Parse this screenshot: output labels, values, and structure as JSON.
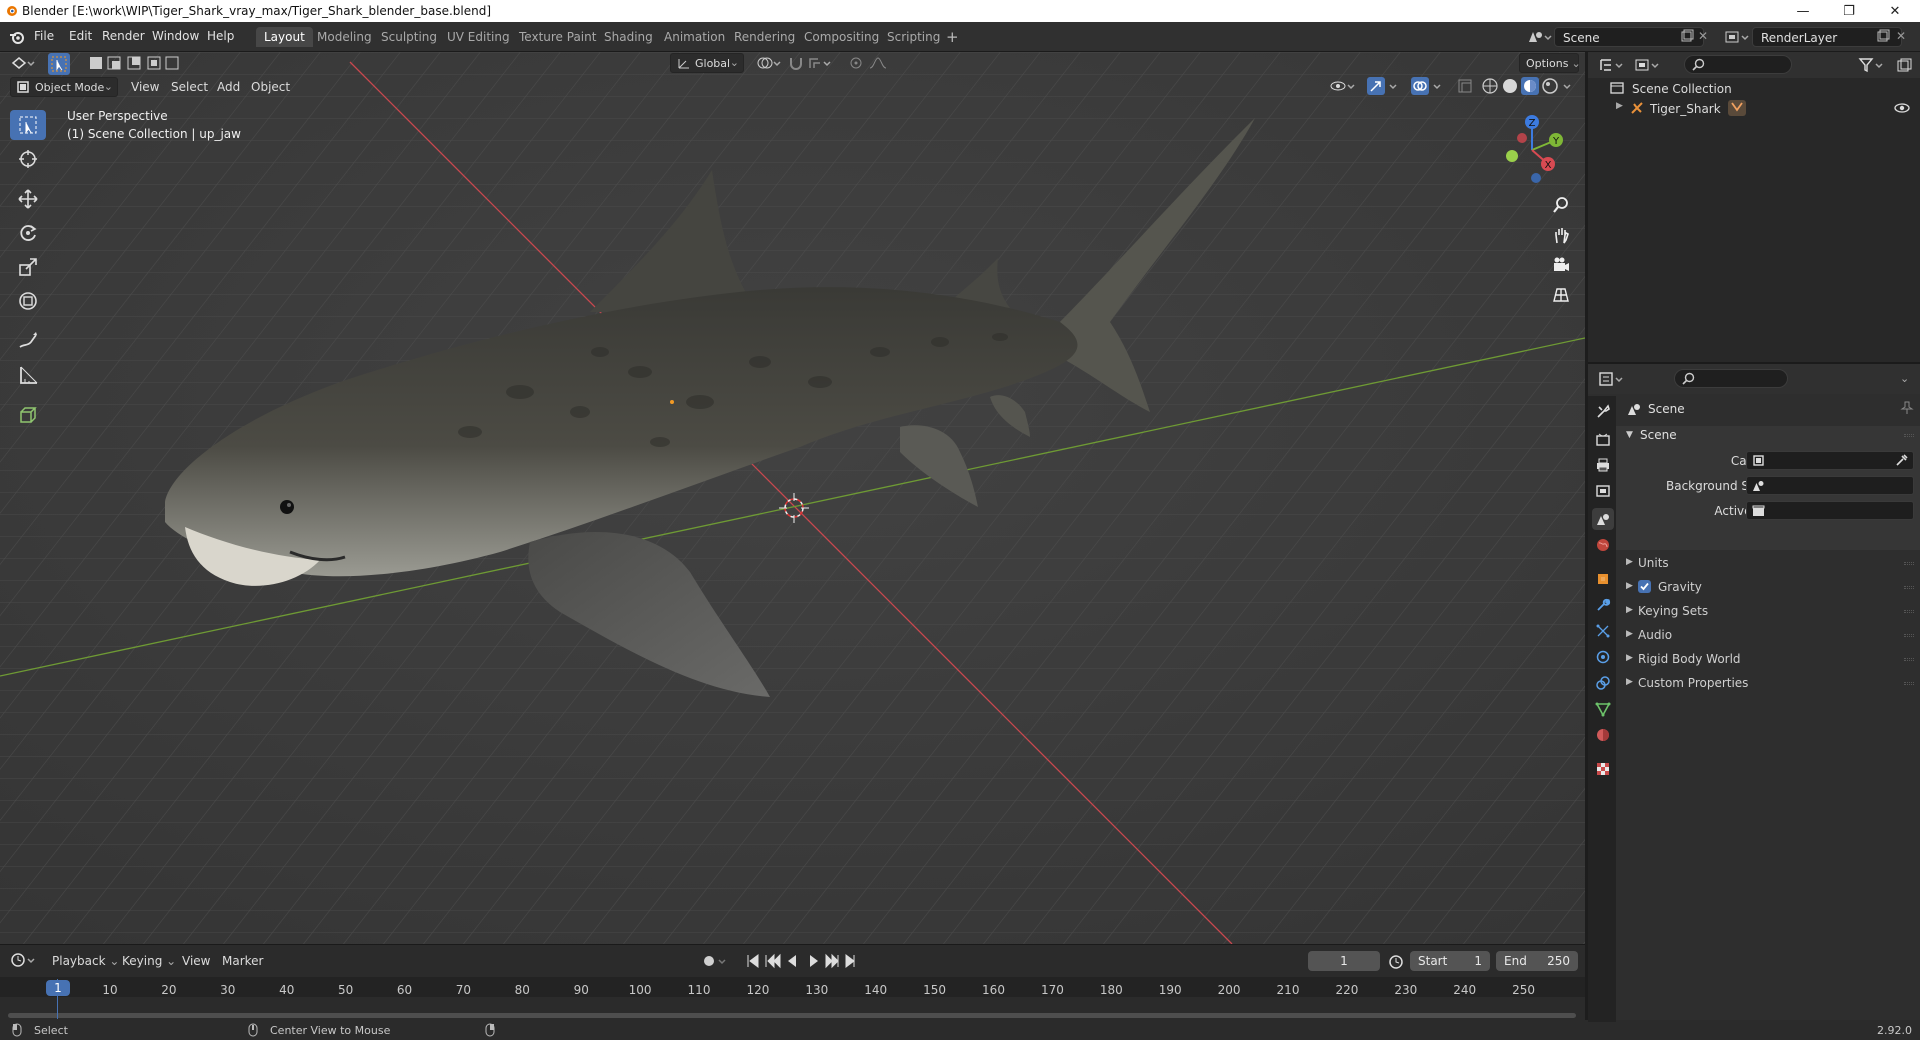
{
  "window": {
    "title": "Blender [E:\\work\\WIP\\Tiger_Shark_vray_max/Tiger_Shark_blender_base.blend]"
  },
  "menu": [
    "File",
    "Edit",
    "Render",
    "Window",
    "Help"
  ],
  "workspaces": [
    "Layout",
    "Modeling",
    "Sculpting",
    "UV Editing",
    "Texture Paint",
    "Shading",
    "Animation",
    "Rendering",
    "Compositing",
    "Scripting"
  ],
  "active_workspace": "Layout",
  "scene_selector": {
    "value": "Scene"
  },
  "view_layer_selector": {
    "value": "RenderLayer"
  },
  "viewport": {
    "mode": "Object Mode",
    "menus": [
      "View",
      "Select",
      "Add",
      "Object"
    ],
    "transform_orientation": "Global",
    "options_label": "Options",
    "overlay_line1": "User Perspective",
    "overlay_line2": "(1) Scene Collection | up_jaw",
    "gizmo_axes": {
      "x": "X",
      "y": "Y",
      "z": "Z"
    }
  },
  "timeline": {
    "menus": [
      "Playback",
      "Keying",
      "View",
      "Marker"
    ],
    "current_frame": "1",
    "start_label": "Start",
    "start_value": "1",
    "end_label": "End",
    "end_value": "250",
    "ruler_marks": [
      "10",
      "20",
      "30",
      "40",
      "50",
      "60",
      "70",
      "80",
      "90",
      "100",
      "110",
      "120",
      "130",
      "140",
      "150",
      "160",
      "170",
      "180",
      "190",
      "200",
      "210",
      "220",
      "230",
      "240",
      "250"
    ]
  },
  "statusbar": {
    "left_hint": "Select",
    "middle_hint": "Center View to Mouse",
    "version": "2.92.0"
  },
  "outliner": {
    "root": "Scene Collection",
    "items": [
      {
        "name": "Tiger_Shark"
      }
    ]
  },
  "properties": {
    "header": "Scene",
    "scene_panel": "Scene",
    "fields": [
      {
        "label": "Camera"
      },
      {
        "label": "Background Scene"
      },
      {
        "label": "Active Clip"
      }
    ],
    "subpanels": [
      "Units",
      "Gravity",
      "Keying Sets",
      "Audio",
      "Rigid Body World",
      "Custom Properties"
    ],
    "gravity_checked": true
  },
  "colors": {
    "accent": "#4772b3",
    "x_axis": "#d84a52",
    "y_axis": "#7fb736",
    "z_axis": "#3c7be0"
  }
}
